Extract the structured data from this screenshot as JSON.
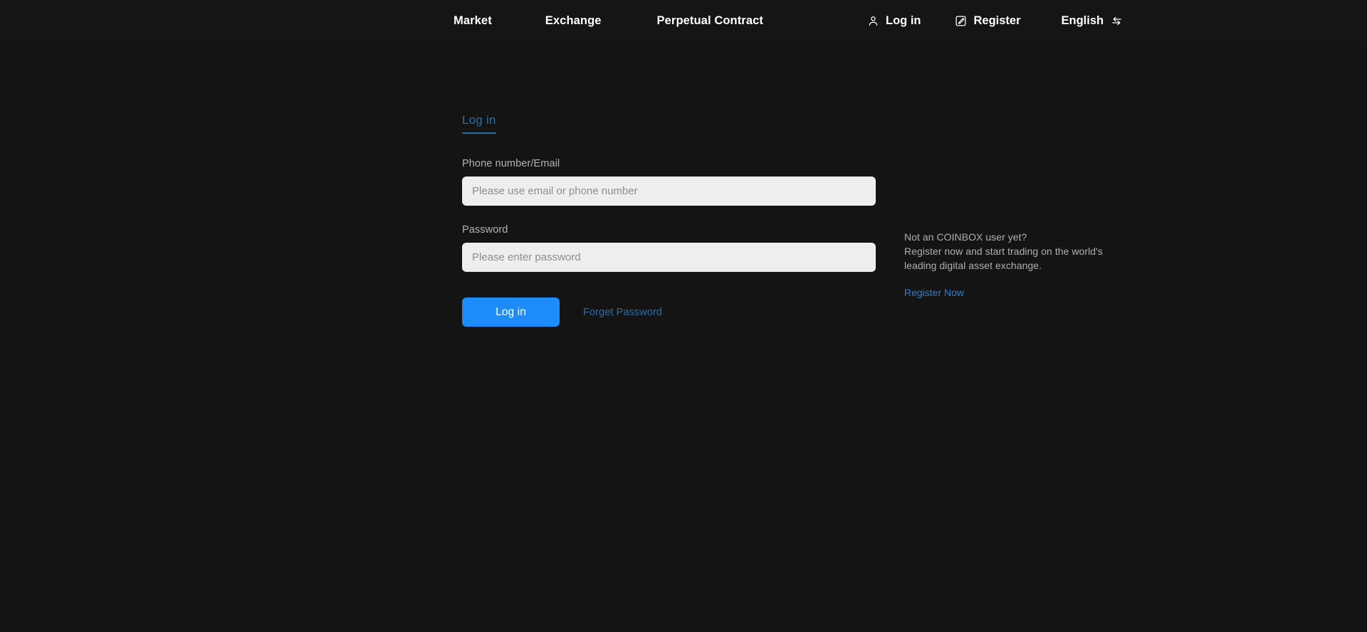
{
  "theme": {
    "background": "#141414",
    "navbar_background": "#151515",
    "accent_blue": "#1d8cf8",
    "muted_blue": "#2c6ea5",
    "link_blue": "#2d7fd0",
    "input_background": "#eeeeee",
    "label_gray": "#b4b4b4",
    "nav_text": "#ffffff"
  },
  "navbar": {
    "items": [
      {
        "label": "Market",
        "name": "nav-item-market"
      },
      {
        "label": "Exchange",
        "name": "nav-item-exchange"
      },
      {
        "label": "Perpetual Contract",
        "name": "nav-item-perpetual-contract"
      }
    ],
    "login": {
      "label": "Log in",
      "icon": "user-icon"
    },
    "register": {
      "label": "Register",
      "icon": "edit-square-icon"
    },
    "language": {
      "label": "English",
      "icon": "swap-arrows-icon"
    }
  },
  "login_form": {
    "tabs": [
      {
        "label": "Log in",
        "active": true
      }
    ],
    "fields": {
      "account": {
        "label": "Phone number/Email",
        "placeholder": "Please use email or phone number",
        "value": ""
      },
      "password": {
        "label": "Password",
        "placeholder": "Please enter password",
        "value": ""
      }
    },
    "submit_label": "Log in",
    "forget_password_label": "Forget Password"
  },
  "promo": {
    "line1": "Not an COINBOX user yet?",
    "line2": "Register now and start trading on the world's",
    "line3": "leading digital asset exchange.",
    "register_link_label": "Register Now"
  }
}
